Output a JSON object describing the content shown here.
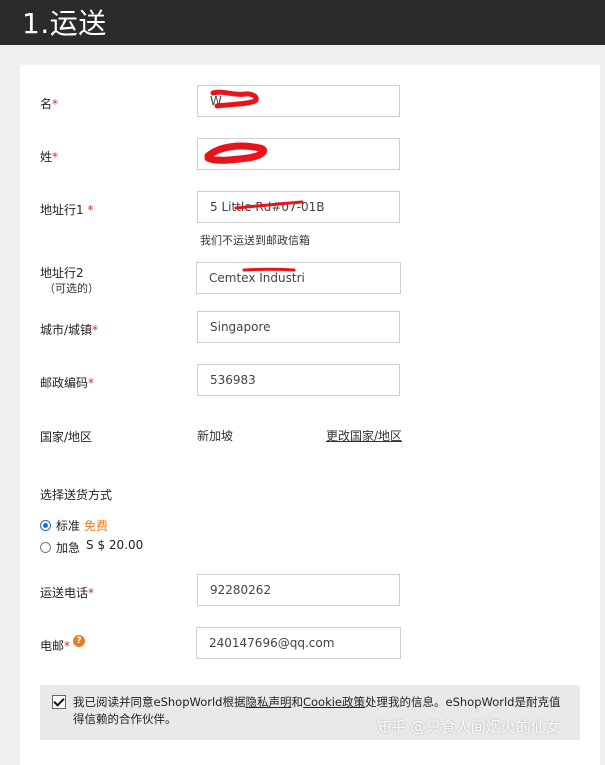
{
  "header": {
    "title": "1.运送"
  },
  "form": {
    "first_name": {
      "label": "名",
      "required_mark": "*",
      "value": "W..."
    },
    "last_name": {
      "label": "姓",
      "required_mark": "*",
      "value": "..."
    },
    "address1": {
      "label": "地址行1",
      "required_mark": "*",
      "value": "5 Little Rd#07-01B",
      "hint": "我们不运送到邮政信箱"
    },
    "address2": {
      "label": "地址行2",
      "sublabel": "（可选的）",
      "value": "Cemtex Industri"
    },
    "city": {
      "label": "城市/城镇",
      "required_mark": "*",
      "value": "Singapore"
    },
    "postal": {
      "label": "邮政编码",
      "required_mark": "*",
      "value": "536983"
    },
    "country": {
      "label": "国家/地区",
      "value": "新加坡",
      "change_link": "更改国家/地区"
    }
  },
  "shipping": {
    "title": "选择送货方式",
    "options": [
      {
        "label": "标准",
        "price": "免费",
        "selected": true
      },
      {
        "label": "加急",
        "price": "S $ 20.00",
        "selected": false
      }
    ]
  },
  "contact": {
    "phone": {
      "label": "运送电话",
      "required_mark": "*",
      "value": "92280262"
    },
    "email": {
      "label": "电邮",
      "required_mark": "*",
      "value": "240147696@qq.com",
      "help_icon": "question-icon"
    }
  },
  "consent": {
    "checked": true,
    "text_before": "我已阅读并同意eShopWorld根据",
    "privacy_link": "隐私声明",
    "text_and": "和",
    "cookie_link": "Cookie政策",
    "text_after": "处理我的信息。eShopWorld是耐克值得信赖的合作伙伴。"
  },
  "watermark": "知乎 @只食人间烟火的仙女",
  "colors": {
    "header_bg": "#2b2b2b",
    "required": "#c0392b",
    "free": "#e67e22",
    "redaction": "#e8141b"
  }
}
